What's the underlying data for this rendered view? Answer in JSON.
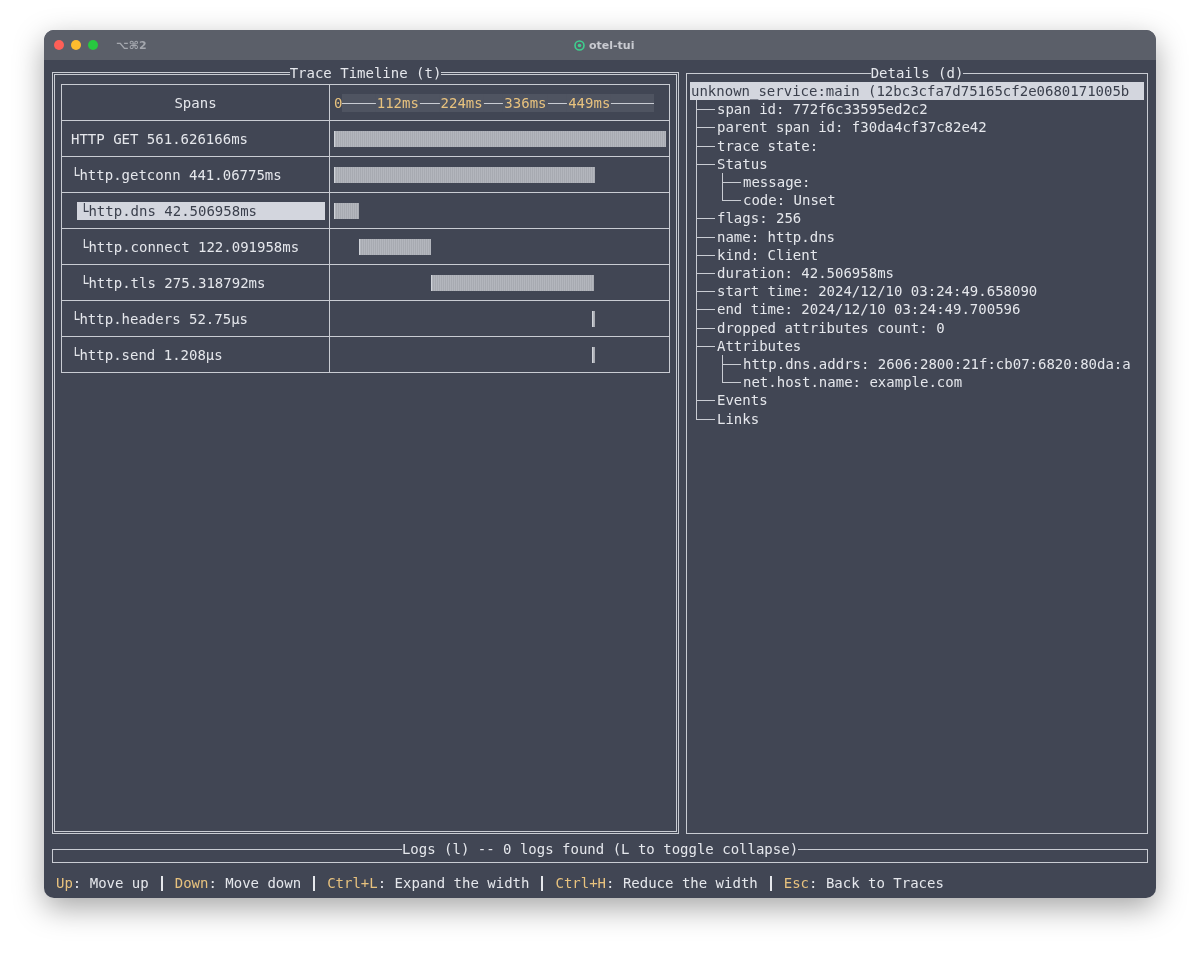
{
  "window": {
    "shortcut": "⌥⌘2",
    "title": "otel-tui"
  },
  "timeline": {
    "title": "Trace Timeline (t)",
    "header": "Spans",
    "ruler": [
      "0",
      "112ms",
      "224ms",
      "336ms",
      "449ms"
    ],
    "spans": [
      {
        "label": "HTTP GET 561.626166ms",
        "selected": false,
        "children": [
          {
            "label": "└http.getconn 441.06775ms",
            "selected": false,
            "children": [
              {
                "label": "└http.dns 42.506958ms",
                "selected": true
              },
              {
                "label": "└http.connect 122.091958ms",
                "selected": false
              },
              {
                "label": "└http.tls 275.318792ms",
                "selected": false
              }
            ]
          },
          {
            "label": "└http.headers 52.75µs",
            "selected": false
          },
          {
            "label": "└http.send 1.208µs",
            "selected": false
          }
        ]
      }
    ]
  },
  "details": {
    "title": "Details (d)",
    "root": {
      "label": "unknown_service:main (12bc3cfa7d75165cf2e0680171005b",
      "selected": true,
      "children": [
        {
          "label": "span id: 772f6c33595ed2c2",
          "selected": false
        },
        {
          "label": "parent span id: f30da4cf37c82e42",
          "selected": false
        },
        {
          "label": "trace state:",
          "selected": false
        },
        {
          "label": "Status",
          "selected": false,
          "children": [
            {
              "label": "message:",
              "selected": false
            },
            {
              "label": "code: Unset",
              "selected": false
            }
          ]
        },
        {
          "label": "flags: 256",
          "selected": false
        },
        {
          "label": "name: http.dns",
          "selected": false
        },
        {
          "label": "kind: Client",
          "selected": false
        },
        {
          "label": "duration: 42.506958ms",
          "selected": false
        },
        {
          "label": "start time: 2024/12/10 03:24:49.658090",
          "selected": false
        },
        {
          "label": "end time: 2024/12/10 03:24:49.700596",
          "selected": false
        },
        {
          "label": "dropped attributes count: 0",
          "selected": false
        },
        {
          "label": "Attributes",
          "selected": false,
          "children": [
            {
              "label": "http.dns.addrs: 2606:2800:21f:cb07:6820:80da:a",
              "selected": false
            },
            {
              "label": "net.host.name: example.com",
              "selected": false
            }
          ]
        },
        {
          "label": "Events",
          "selected": false
        },
        {
          "label": "Links",
          "selected": false
        }
      ]
    }
  },
  "logs": {
    "title": "Logs (l) -- 0 logs found (L to toggle collapse)"
  },
  "key_hints": [
    {
      "key": "Up",
      "action": ": Move up"
    },
    {
      "key": "Down",
      "action": ": Move down"
    },
    {
      "key": "Ctrl+L",
      "action": ": Expand the width"
    },
    {
      "key": "Ctrl+H",
      "action": ": Reduce the width"
    },
    {
      "key": "Esc",
      "action": ": Back to Traces"
    }
  ]
}
